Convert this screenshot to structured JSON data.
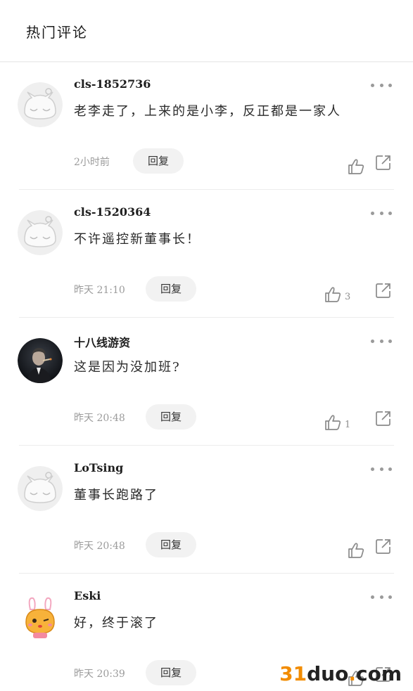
{
  "header": {
    "title": "热门评论"
  },
  "comments": [
    {
      "username": "cls-1852736",
      "content": "老李走了，上来的是小李，反正都是一家人",
      "time": "2小时前",
      "reply_label": "回复",
      "likes": "",
      "avatar": "default-cat"
    },
    {
      "username": "cls-1520364",
      "content": "不许遥控新董事长！",
      "time": "昨天 21:10",
      "reply_label": "回复",
      "likes": "3",
      "avatar": "default-cat"
    },
    {
      "username": "十八线游资",
      "content": "这是因为没加班?",
      "time": "昨天 20:48",
      "reply_label": "回复",
      "likes": "1",
      "avatar": "photo-smoking-man"
    },
    {
      "username": "LoTsing",
      "content": "董事长跑路了",
      "time": "昨天 20:48",
      "reply_label": "回复",
      "likes": "",
      "avatar": "default-cat"
    },
    {
      "username": "Eski",
      "content": "好，终于滚了",
      "time": "昨天 20:39",
      "reply_label": "回复",
      "likes": "",
      "avatar": "cartoon-bunny-cat"
    }
  ],
  "watermark": {
    "num": "31",
    "txt": "duo",
    "dot": ".",
    "tld": "com"
  },
  "colors": {
    "accent_orange": "#f28c00",
    "icon_gray": "#8a8a8a",
    "pill_bg": "#f2f2f2"
  }
}
